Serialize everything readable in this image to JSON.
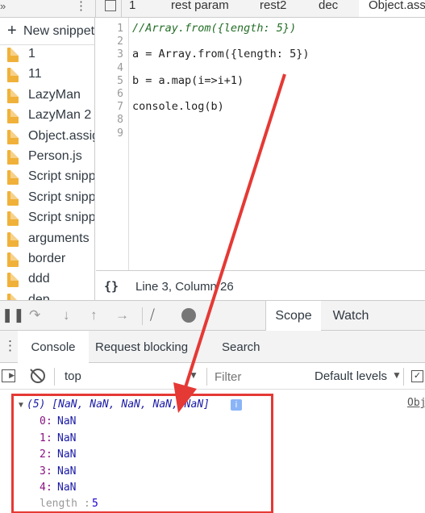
{
  "tabs": {
    "items": [
      "1",
      "rest param",
      "rest2",
      "dec",
      "Object.assi"
    ],
    "active_index": 4
  },
  "sidebar": {
    "new_snippet": "New snippet",
    "items": [
      "1",
      "11",
      "LazyMan",
      "LazyMan 2",
      "Object.assig",
      "Person.js",
      "Script snipp",
      "Script snipp",
      "Script snipp",
      "arguments",
      "border",
      "ddd",
      "dep"
    ]
  },
  "editor": {
    "line_numbers": [
      "1",
      "2",
      "3",
      "4",
      "5",
      "6",
      "7",
      "8",
      "9"
    ],
    "lines": [
      "//Array.from({length: 5})",
      "",
      "a = Array.from({length: 5})",
      "",
      "b = a.map(i=>i+1)",
      "",
      "console.log(b)",
      "",
      ""
    ],
    "status": "Line 3, Column 26",
    "format_icon": "{}"
  },
  "debugger": {
    "icons": [
      "pause-icon",
      "step-over-icon",
      "step-into-icon",
      "step-out-icon",
      "step-icon",
      "deactivate-breakpoints-icon",
      "pause-on-exceptions-icon"
    ],
    "tabs": [
      "Scope",
      "Watch"
    ],
    "active_tab": "Scope"
  },
  "console_tabs": {
    "items": [
      "Console",
      "Request blocking",
      "Search"
    ],
    "active": "Console"
  },
  "console_toolbar": {
    "context": "top",
    "filter_placeholder": "Filter",
    "levels": "Default levels"
  },
  "output": {
    "summary": "(5) [NaN, NaN, NaN, NaN, NaN]",
    "info_badge": "i",
    "source_link": "Obj",
    "entries": [
      {
        "key": "0",
        "value": "NaN"
      },
      {
        "key": "1",
        "value": "NaN"
      },
      {
        "key": "2",
        "value": "NaN"
      },
      {
        "key": "3",
        "value": "NaN"
      },
      {
        "key": "4",
        "value": "NaN"
      }
    ],
    "length_key": "length",
    "length_value": "5"
  },
  "colors": {
    "annotation_red": "#e53935",
    "folder_yellow": "#f0b13a",
    "accent_blue": "#1a73e8"
  }
}
